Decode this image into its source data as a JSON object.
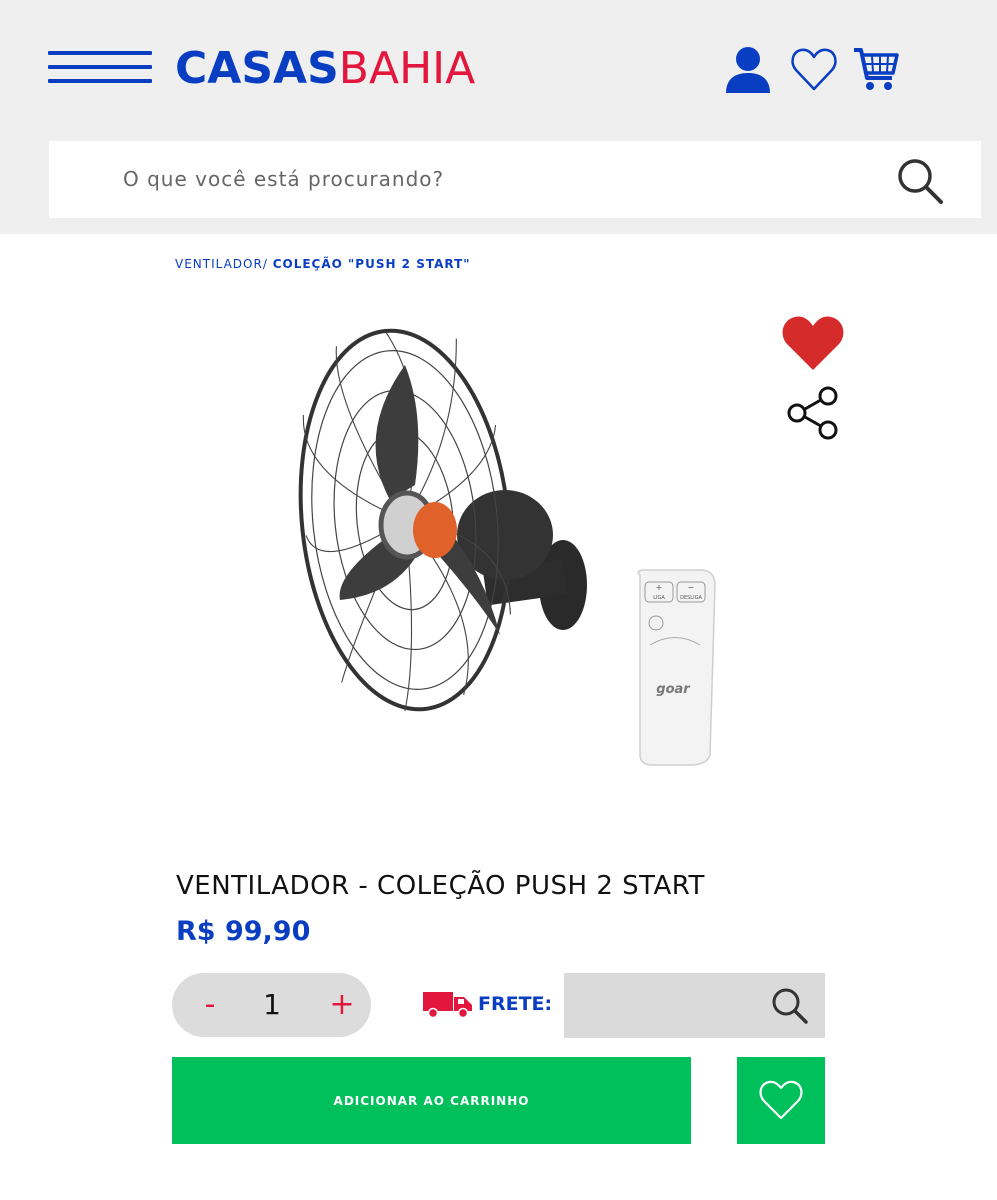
{
  "header": {
    "logo_part1": "CASAS",
    "logo_part2": "BAHIA",
    "icons": [
      "menu-icon",
      "user-icon",
      "heart-outline-icon",
      "cart-icon"
    ],
    "brand_blue": "#0a3ec2",
    "brand_red": "#e3173e"
  },
  "search": {
    "placeholder": "O que você está procurando?",
    "value": ""
  },
  "breadcrumb": {
    "item1": "VENTILADOR/",
    "item2": "COLEÇÃO \"PUSH 2 START\""
  },
  "product": {
    "title": "VENTILADOR - COLEÇÃO PUSH 2 START",
    "price": "R$ 99,90",
    "image_label": "goar",
    "remote_labels": {
      "plus": "+",
      "minus": "−",
      "liga": "LIGA",
      "desliga": "DESLIGA"
    }
  },
  "quantity": {
    "minus_label": "-",
    "value": "1",
    "plus_label": "+"
  },
  "frete": {
    "label": "FRETE:",
    "value": ""
  },
  "actions": {
    "add_to_cart": "ADICIONAR AO CARRINHO"
  },
  "colors": {
    "header_bg": "#efeff0",
    "green": "#00c05c",
    "heart_red": "#d62b2b"
  }
}
